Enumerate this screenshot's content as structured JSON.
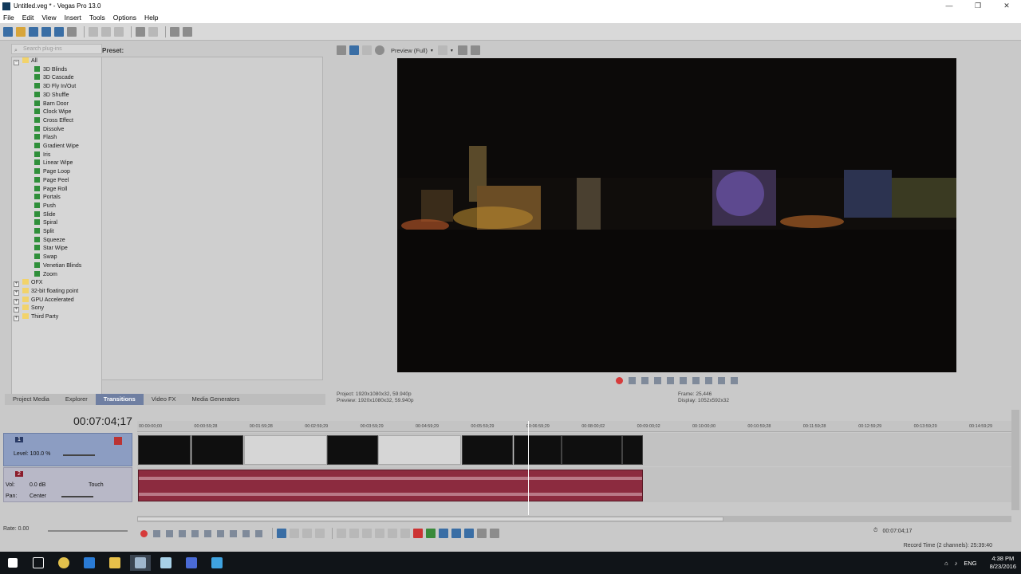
{
  "window": {
    "title": "Untitled.veg * - Vegas Pro 13.0",
    "minimize": "—",
    "maximize": "❐",
    "close": "✕"
  },
  "menu": [
    "File",
    "Edit",
    "View",
    "Insert",
    "Tools",
    "Options",
    "Help"
  ],
  "explorer": {
    "search_placeholder": "Search plug-ins",
    "preset_label": "Preset:",
    "tree": {
      "root": "All",
      "transitions": [
        "3D Blinds",
        "3D Cascade",
        "3D Fly In/Out",
        "3D Shuffle",
        "Barn Door",
        "Clock Wipe",
        "Cross Effect",
        "Dissolve",
        "Flash",
        "Gradient Wipe",
        "Iris",
        "Linear Wipe",
        "Page Loop",
        "Page Peel",
        "Page Roll",
        "Portals",
        "Push",
        "Slide",
        "Spiral",
        "Split",
        "Squeeze",
        "Star Wipe",
        "Swap",
        "Venetian Blinds",
        "Zoom"
      ],
      "groups": [
        "OFX",
        "32-bit floating point",
        "GPU Accelerated",
        "Sony",
        "Third Party"
      ]
    },
    "tabs": [
      "Project Media",
      "Explorer",
      "Transitions",
      "Video FX",
      "Media Generators"
    ],
    "active_tab": "Transitions"
  },
  "preview": {
    "quality_label": "Preview (Full)",
    "project_line": "Project:   1920x1080x32, 59.940p",
    "preview_line": "Preview:   1920x1080x32, 59.940p",
    "frame_line": "Frame:     25,446",
    "display_line": "Display:   1052x592x32"
  },
  "timeline": {
    "timecode": "00:07:04;17",
    "ruler": [
      "00:00:00;00",
      "00:00:59;28",
      "00:01:59;28",
      "00:02:59;29",
      "00:03:59;29",
      "00:04:59;29",
      "00:05:59;29",
      "00:06:59;29",
      "00:08:00;02",
      "00:09:00;02",
      "00:10:00;00",
      "00:10:59;28",
      "00:11:59;28",
      "00:12:59;29",
      "00:13:59;29",
      "00:14:59;29"
    ],
    "video_track": {
      "number": "1",
      "level_label": "Level: 100.0 %"
    },
    "audio_track": {
      "number": "2",
      "vol_label": "Vol:",
      "vol_value": "0.0 dB",
      "touch_label": "Touch",
      "pan_label": "Pan:",
      "pan_value": "Center"
    },
    "rate_label": "Rate: 0.00",
    "cursor_time": "00:07:04;17",
    "record_time": "Record Time (2 channels): 25:39:40"
  },
  "taskbar": {
    "lang": "ENG",
    "time": "4:38 PM",
    "date": "8/23/2016"
  }
}
